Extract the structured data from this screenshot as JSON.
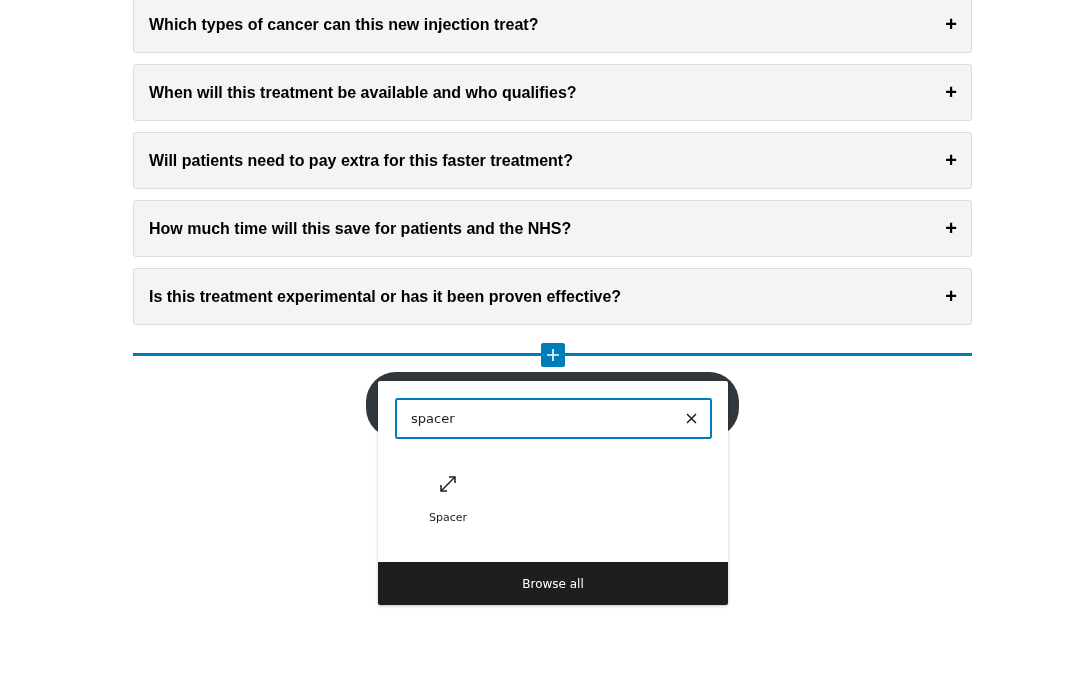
{
  "faq": [
    {
      "question": "Which types of cancer can this new injection treat?",
      "toggle": "+",
      "expanded": false
    },
    {
      "question": "When will this treatment be available and who qualifies?",
      "toggle": "+",
      "expanded": false
    },
    {
      "question": "Will patients need to pay extra for this faster treatment?",
      "toggle": "+",
      "expanded": false
    },
    {
      "question": "How much time will this save for patients and the NHS?",
      "toggle": "+",
      "expanded": false
    },
    {
      "question": "Is this treatment experimental or has it been proven effective?",
      "toggle": "+",
      "expanded": false
    }
  ],
  "inserter": {
    "search": {
      "value": "spacer"
    },
    "results": [
      {
        "label": "Spacer"
      }
    ],
    "browse_all": "Browse all"
  }
}
